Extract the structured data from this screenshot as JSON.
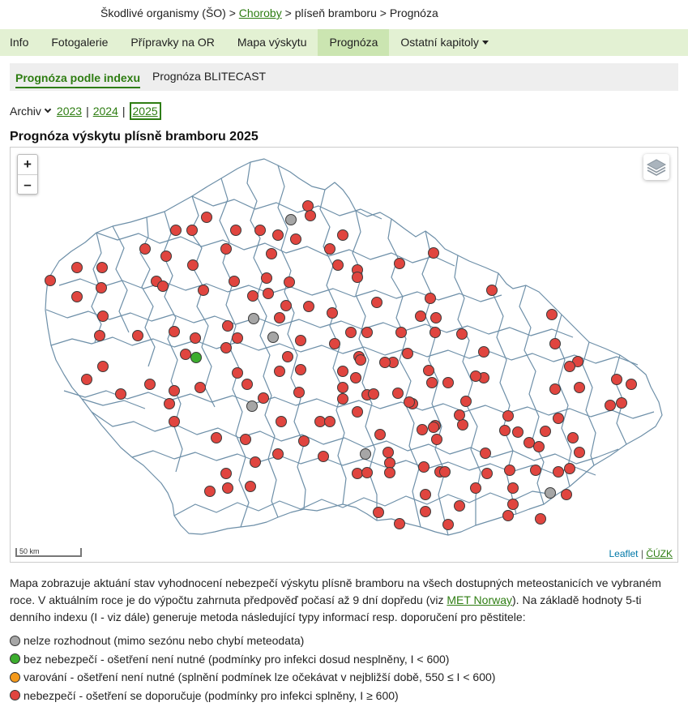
{
  "breadcrumb": {
    "part1": "Škodlivé organismy (ŠO)",
    "sep": ">",
    "link": "Choroby",
    "part2": "plíseň bramboru",
    "part3": "Prognóza"
  },
  "nav": {
    "items": [
      {
        "label": "Info"
      },
      {
        "label": "Fotogalerie"
      },
      {
        "label": "Přípravky na OR"
      },
      {
        "label": "Mapa výskytu"
      },
      {
        "label": "Prognóza",
        "active": true
      },
      {
        "label": "Ostatní kapitoly",
        "dropdown": true
      }
    ]
  },
  "subtabs": {
    "items": [
      {
        "label": "Prognóza podle indexu",
        "active": true
      },
      {
        "label": "Prognóza BLITECAST"
      }
    ]
  },
  "years": {
    "archiv_label": "Archiv",
    "separator": "|",
    "items": [
      "2023",
      "2024",
      "2025"
    ],
    "current": "2025"
  },
  "map": {
    "title": "Prognóza výskytu plísně bramboru 2025",
    "zoom_in": "+",
    "zoom_out": "–",
    "scale_label": "50 km",
    "attribution": {
      "leaflet": "Leaflet",
      "sep": "|",
      "cuzk": "ČÚZK"
    },
    "colors": {
      "gray": "#a6a6a6",
      "green": "#3cad2e",
      "orange": "#f59a1b",
      "red": "#e0453f",
      "border": "#6d8fa8"
    },
    "icons": {
      "layers": "layers-icon"
    }
  },
  "description": {
    "text1": "Mapa zobrazuje aktuání stav vyhodnocení nebezpečí výskytu plísně bramboru na všech dostupných meteostanicích ve vybraném roce. V aktuálním roce je do výpočtu zahrnuta předpověď počasí až 9 dní dopředu (viz ",
    "link": "MET Norway",
    "text2": "). Na základě hodnoty 5-ti denního indexu (I - viz dále) generuje metoda následující typy informací resp. doporučení pro pěstitele:"
  },
  "legend": {
    "items": [
      {
        "color": "#a6a6a6",
        "label": "nelze rozhodnout (mimo sezónu nebo chybí meteodata)"
      },
      {
        "color": "#3cad2e",
        "label": "bez nebezpečí - ošetření není nutné (podmínky pro infekci dosud nesplněny, I < 600)"
      },
      {
        "color": "#f59a1b",
        "label": "varování - ošetření není nutné (splnění podmínek lze očekávat v nejbližší době, 550 ≤ I < 600)"
      },
      {
        "color": "#e0453f",
        "label": "nebezpečí - ošetření se doporučuje (podmínky pro infekci splněny, I ≥ 600)"
      }
    ]
  }
}
